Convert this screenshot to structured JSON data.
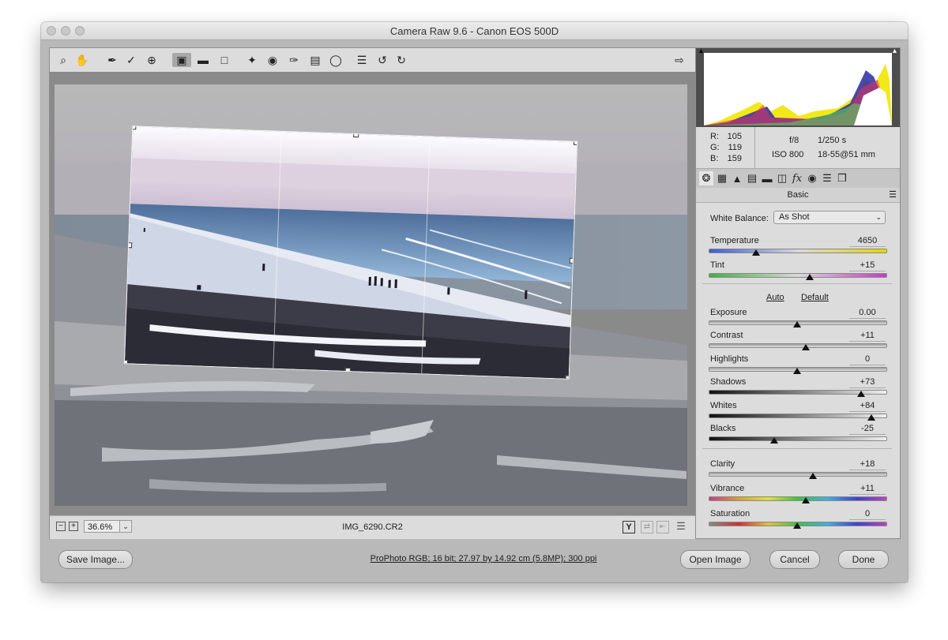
{
  "window": {
    "title": "Camera Raw 9.6  -  Canon EOS 500D"
  },
  "colors": {
    "accent_active": "#a8a8a8",
    "panel": "#dcdcdc",
    "window": "#b9b9b9",
    "histogram_bg": "#4d4d4d"
  },
  "toolbar": {
    "tools": [
      {
        "name": "zoom-icon"
      },
      {
        "name": "hand-icon"
      },
      {
        "name": "white-balance-icon"
      },
      {
        "name": "color-sampler-icon"
      },
      {
        "name": "targeted-adjustment-icon"
      },
      {
        "name": "crop-icon",
        "active": true
      },
      {
        "name": "straighten-icon"
      },
      {
        "name": "transform-icon"
      },
      {
        "name": "spot-removal-icon"
      },
      {
        "name": "red-eye-icon"
      },
      {
        "name": "adjustment-brush-icon"
      },
      {
        "name": "graduated-filter-icon"
      },
      {
        "name": "radial-filter-icon"
      },
      {
        "name": "preferences-icon"
      },
      {
        "name": "rotate-ccw-icon"
      },
      {
        "name": "rotate-cw-icon"
      }
    ],
    "fullscreen_icon": "fullscreen-icon"
  },
  "status": {
    "zoom": "36.6%",
    "filename": "IMG_6290.CR2",
    "y_icon": "Y"
  },
  "readout": {
    "r_label": "R:",
    "r": "105",
    "g_label": "G:",
    "g": "119",
    "b_label": "B:",
    "b": "159",
    "aperture": "f/8",
    "shutter": "1/250 s",
    "iso": "ISO 800",
    "lens": "18-55@51 mm"
  },
  "panel": {
    "title": "Basic",
    "wb_label": "White Balance:",
    "wb_value": "As Shot",
    "auto": "Auto",
    "default": "Default",
    "sliders": [
      {
        "label": "Temperature",
        "value": "4650",
        "frac": 0.27
      },
      {
        "label": "Tint",
        "value": "+15",
        "frac": 0.57
      },
      {
        "label": "Exposure",
        "value": "0.00",
        "frac": 0.5
      },
      {
        "label": "Contrast",
        "value": "+11",
        "frac": 0.55
      },
      {
        "label": "Highlights",
        "value": "0",
        "frac": 0.5
      },
      {
        "label": "Shadows",
        "value": "+73",
        "frac": 0.86
      },
      {
        "label": "Whites",
        "value": "+84",
        "frac": 0.92
      },
      {
        "label": "Blacks",
        "value": "-25",
        "frac": 0.37
      },
      {
        "label": "Clarity",
        "value": "+18",
        "frac": 0.59
      },
      {
        "label": "Vibrance",
        "value": "+11",
        "frac": 0.55
      },
      {
        "label": "Saturation",
        "value": "0",
        "frac": 0.5
      }
    ]
  },
  "footer": {
    "save": "Save Image...",
    "workflow": "ProPhoto RGB; 16 bit; 27.97 by 14.92 cm (5.8MP); 300 ppi",
    "open": "Open Image",
    "cancel": "Cancel",
    "done": "Done"
  }
}
